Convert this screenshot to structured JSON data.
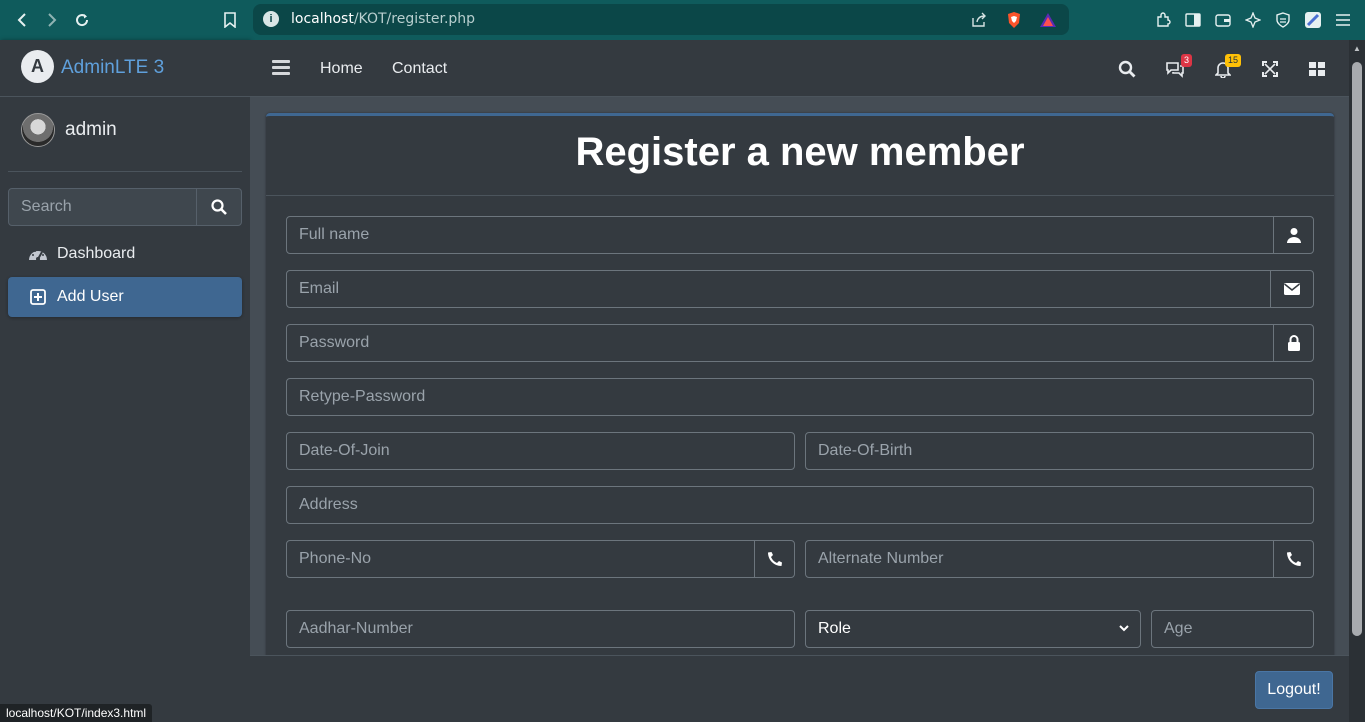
{
  "browser": {
    "url_host": "localhost",
    "url_path": "/KOT/register.php",
    "status_url": "localhost/KOT/index3.html"
  },
  "sidebar": {
    "brand": "AdminLTE 3",
    "user_name": "admin",
    "search_placeholder": "Search",
    "items": [
      {
        "label": "Dashboard",
        "icon": "tachometer-icon",
        "active": false
      },
      {
        "label": "Add User",
        "icon": "plus-square-icon",
        "active": true
      }
    ]
  },
  "topnav": {
    "links": [
      "Home",
      "Contact"
    ],
    "messages_badge": "3",
    "notifications_badge": "15"
  },
  "form": {
    "title": "Register a new member",
    "full_name_placeholder": "Full name",
    "email_placeholder": "Email",
    "password_placeholder": "Password",
    "retype_password_placeholder": "Retype-Password",
    "date_of_join_placeholder": "Date-Of-Join",
    "date_of_birth_placeholder": "Date-Of-Birth",
    "address_placeholder": "Address",
    "phone_placeholder": "Phone-No",
    "alternate_number_placeholder": "Alternate Number",
    "aadhar_placeholder": "Aadhar-Number",
    "role_selected": "Role",
    "age_placeholder": "Age"
  },
  "footer": {
    "logout_label": "Logout!"
  },
  "colors": {
    "accent": "#3f6791",
    "browser_bar": "#0f5b5c",
    "sidebar_bg": "#343a40",
    "badge_red": "#dc3545",
    "badge_yellow": "#ffc107"
  }
}
